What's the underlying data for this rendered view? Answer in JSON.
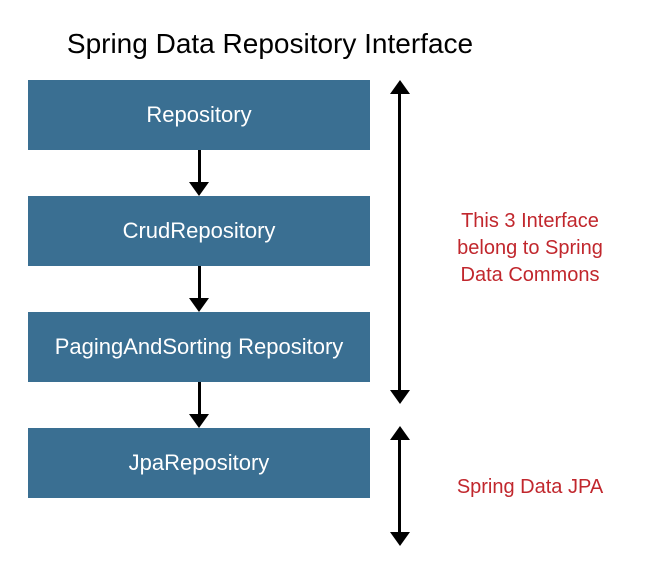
{
  "title": "Spring Data Repository Interface",
  "boxes": {
    "repository": "Repository",
    "crud": "CrudRepository",
    "paging": "PagingAndSorting Repository",
    "jpa": "JpaRepository"
  },
  "annotations": {
    "commons": "This 3 Interface belong to Spring Data Commons",
    "jpa": "Spring Data JPA"
  }
}
